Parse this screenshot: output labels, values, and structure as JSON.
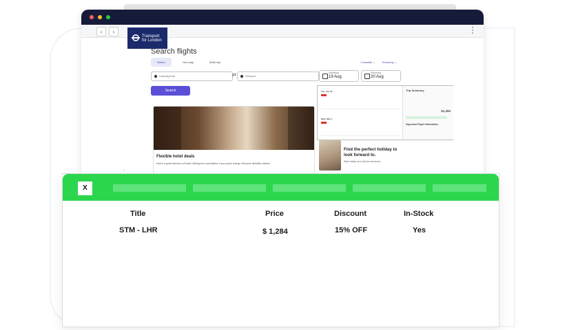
{
  "browser": {
    "logo_line1": "Transport",
    "logo_line2": "for London"
  },
  "search": {
    "title": "Search flights",
    "trip_types": [
      "Return",
      "One-way",
      "Multi-city"
    ],
    "traveller": "1 traveller ⌄",
    "cabin": "Economy ⌄",
    "from_placeholder": "Leaving from",
    "to_placeholder": "Going to",
    "departing_label": "Departing",
    "departing_value": "19 Aug",
    "returning_label": "Returning",
    "returning_value": "20 Aug",
    "search_button": "Search"
  },
  "hotel": {
    "title": "Flexible hotel deals",
    "description": "Here's a great selection of hotels offering free cancellation if your plans change. Because flexibility matters."
  },
  "promo": {
    "title": "Find the perfect holiday to look forward to.",
    "subtitle": "Save today on a trip for tomorrow"
  },
  "popup": {
    "summary_title": "Trip Summary",
    "outbound_date": "Tue, Jun 20",
    "return_date": "Wed, May 4",
    "price": "$1,284",
    "info_title": "Important Flight Information"
  },
  "overlay": {
    "close_label": "X",
    "columns": [
      "Title",
      "Price",
      "Discount",
      "In-Stock"
    ],
    "row": [
      "STM - LHR",
      "$ 1,284",
      "15% OFF",
      "Yes"
    ]
  }
}
